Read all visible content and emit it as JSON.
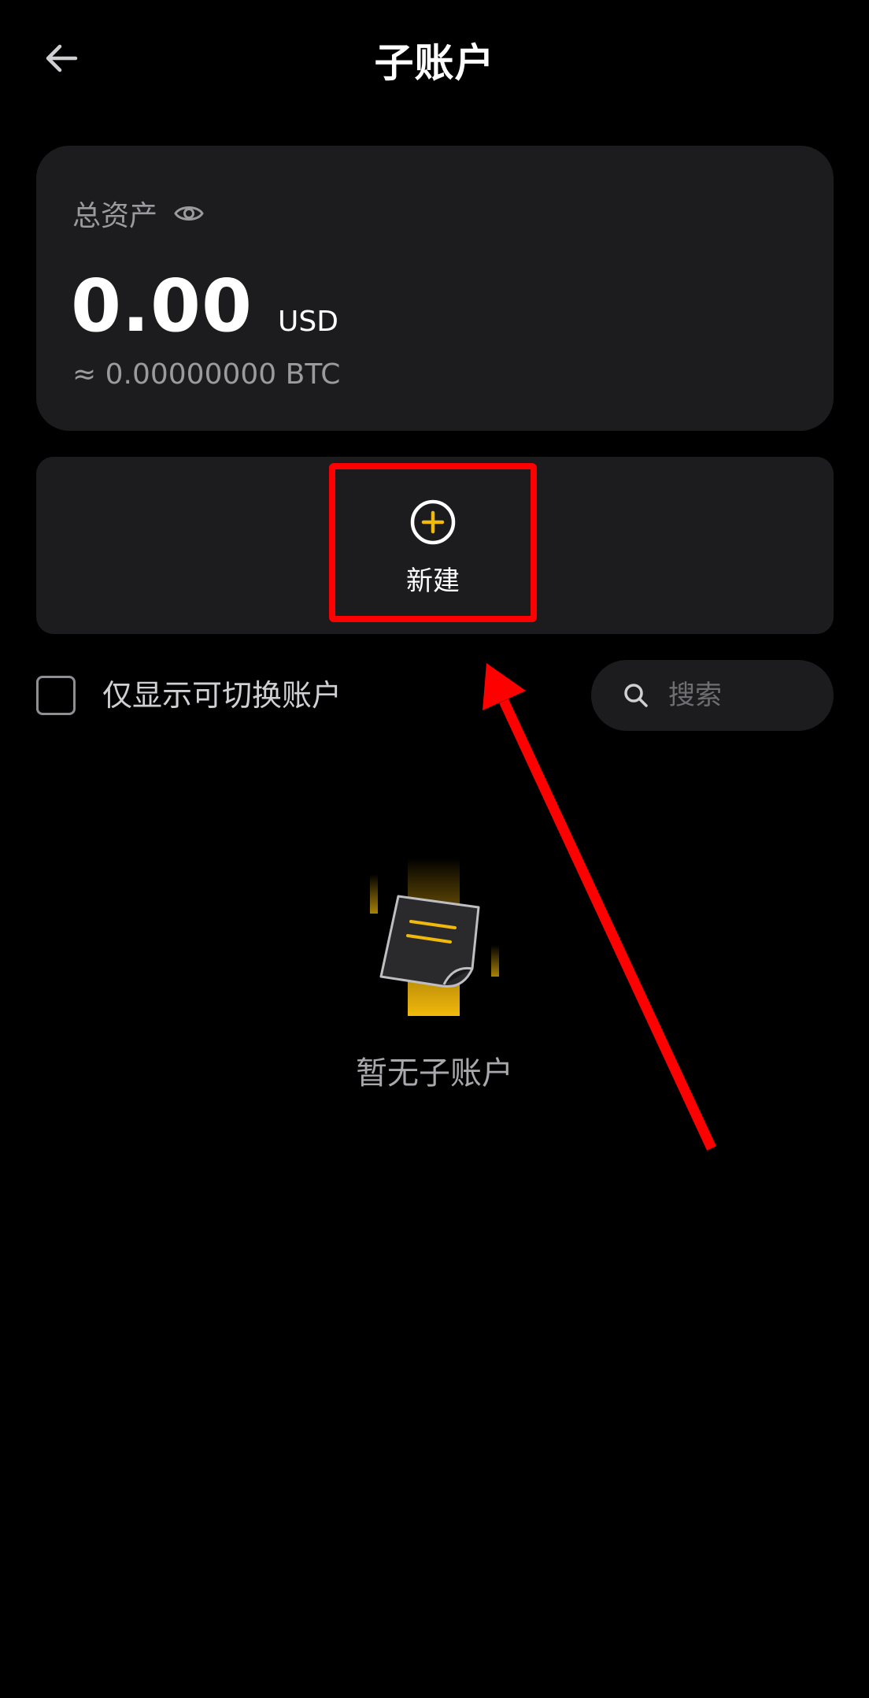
{
  "header": {
    "title": "子账户",
    "back_icon": "arrow-left-icon"
  },
  "asset_card": {
    "label": "总资产",
    "eye_icon": "eye-icon",
    "amount": "0.00",
    "currency": "USD",
    "btc_equivalent": "≈ 0.00000000 BTC"
  },
  "create": {
    "label": "新建",
    "icon": "plus-circle-icon",
    "accent_color": "#f0b90b"
  },
  "filter": {
    "checkbox_label": "仅显示可切换账户",
    "checked": false
  },
  "search": {
    "placeholder": "搜索",
    "value": ""
  },
  "empty_state": {
    "text": "暂无子账户",
    "icon": "empty-document-icon"
  },
  "annotation": {
    "color": "#ff0000"
  }
}
